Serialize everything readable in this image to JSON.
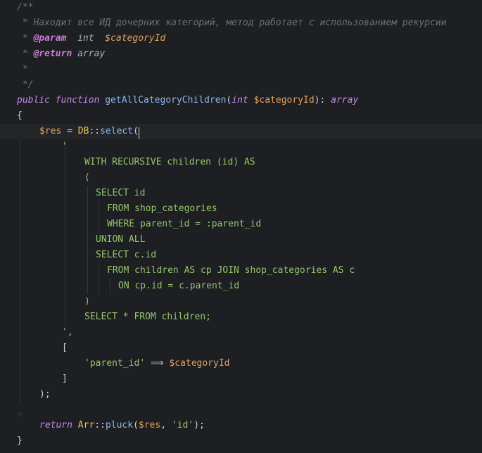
{
  "editor": {
    "lines": [
      [
        "/**"
      ],
      [
        " * Находит все ИД дочерних категорий, метод работает с использованием рекурсии"
      ],
      [
        " * ",
        "@param",
        "  int  ",
        "$categoryId"
      ],
      [
        " * ",
        "@return",
        " array"
      ],
      [
        " *"
      ],
      [
        " */"
      ],
      [
        "public function",
        " ",
        "getAllCategoryChildren",
        "(",
        "int",
        " ",
        "$categoryId",
        "): ",
        "array"
      ],
      [
        "{"
      ],
      [
        "$res",
        " = ",
        "DB",
        "::",
        "select",
        "("
      ],
      [
        "'"
      ],
      [
        "WITH RECURSIVE children (id) AS"
      ],
      [
        "("
      ],
      [
        "SELECT id"
      ],
      [
        "FROM shop_categories"
      ],
      [
        "WHERE parent_id = :parent_id"
      ],
      [
        "UNION ALL"
      ],
      [
        "SELECT c.id"
      ],
      [
        "FROM children AS cp JOIN shop_categories AS c"
      ],
      [
        "ON cp.id = c.parent_id"
      ],
      [
        ")"
      ],
      [
        "SELECT * FROM children;"
      ],
      [
        "',"
      ],
      [
        "["
      ],
      [
        "'parent_id'",
        " ⟹ ",
        "$categoryId"
      ],
      [
        "]"
      ],
      [
        ");"
      ],
      [
        ""
      ],
      [
        "return",
        " ",
        "Arr",
        "::",
        "pluck",
        "(",
        "$res",
        ", ",
        "'id'",
        ");"
      ],
      [
        "}"
      ]
    ]
  },
  "colors": {
    "background": "#1e1f22",
    "comment": "#6b7078",
    "doc_tag": "#c77dd6",
    "keyword": "#c586e8",
    "function": "#88b6ec",
    "variable": "#e0a15f",
    "string": "#93c46c",
    "class": "#e8c15a",
    "text": "#c9ced6"
  }
}
